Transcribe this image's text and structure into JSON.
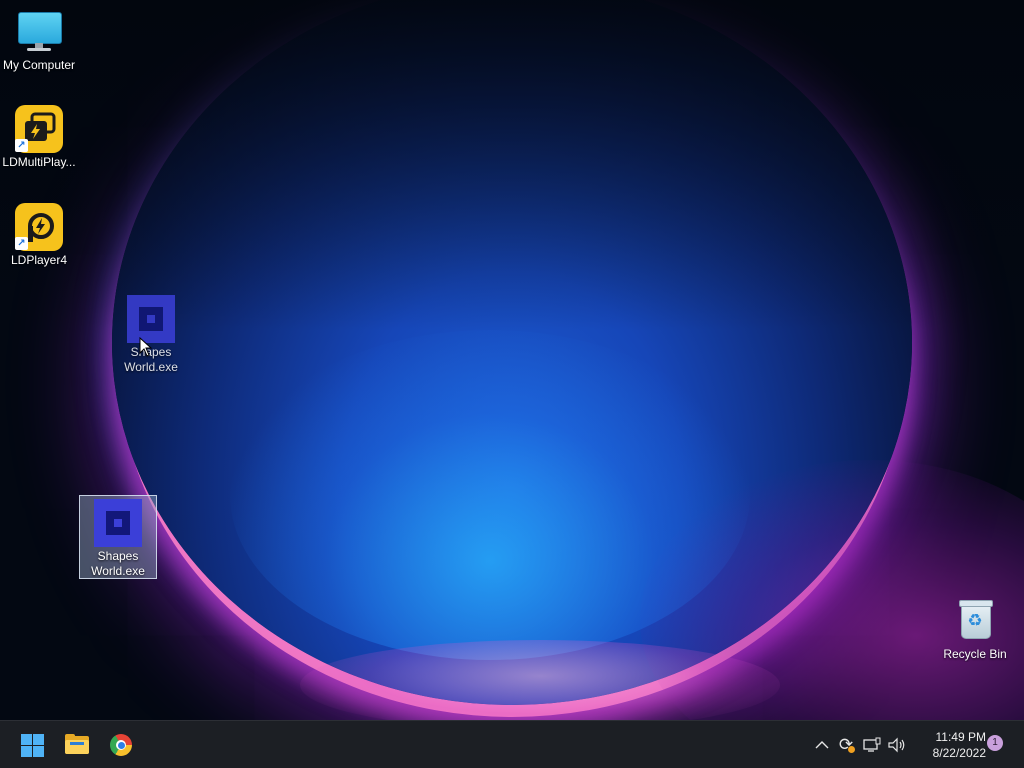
{
  "desktop": {
    "icons": {
      "my_computer": {
        "label": "My Computer",
        "icon": "monitor-icon"
      },
      "ldmultiplayer": {
        "label": "LDMultiPlay...",
        "icon": "ldmultiplayer-icon"
      },
      "ldplayer4": {
        "label": "LDPlayer4",
        "icon": "ldplayer-icon"
      },
      "shapes_world_drag": {
        "label": "Shapes World.exe",
        "icon": "shapes-world-icon"
      },
      "shapes_world": {
        "label": "Shapes World.exe",
        "icon": "shapes-world-icon"
      },
      "recycle_bin": {
        "label": "Recycle Bin",
        "icon": "recycle-bin-icon"
      }
    }
  },
  "taskbar": {
    "pinned": [
      {
        "name": "Start",
        "icon": "windows-start-icon"
      },
      {
        "name": "File Explorer",
        "icon": "folder-icon"
      },
      {
        "name": "Google Chrome",
        "icon": "chrome-icon"
      }
    ],
    "tray": {
      "overflow": "^",
      "sync": "⟳",
      "network": "▭",
      "volume": "🔊"
    },
    "clock": {
      "time": "11:49 PM",
      "date": "8/22/2022"
    },
    "notifications": "1"
  },
  "colors": {
    "taskbar_bg": "#1c1f24",
    "ld_yellow": "#f6c21c",
    "shapes_blue": "#3b3fd8",
    "start_blue": "#4fb3f6"
  }
}
